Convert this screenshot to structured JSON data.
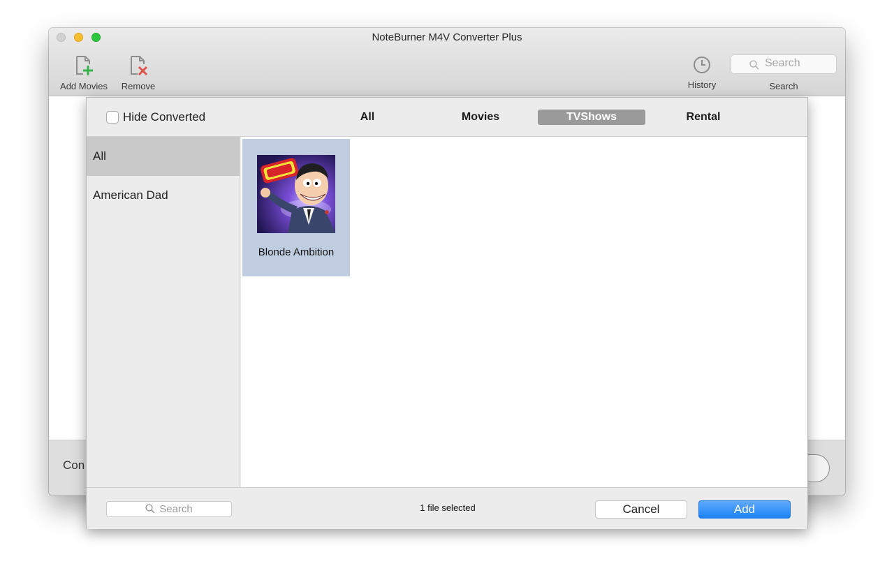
{
  "window": {
    "title": "NoteBurner M4V Converter Plus"
  },
  "toolbar": {
    "add_movies_label": "Add Movies",
    "add_movies_icon": "add-file-icon",
    "remove_label": "Remove",
    "remove_icon": "remove-file-icon",
    "history_label": "History",
    "history_icon": "clock-icon",
    "search_placeholder": "Search",
    "search_label": "Search"
  },
  "main": {
    "bottom_left_text": "Con"
  },
  "dialog": {
    "hide_converted_label": "Hide Converted",
    "hide_converted_checked": false,
    "tabs": [
      {
        "label": "All",
        "selected": false
      },
      {
        "label": "Movies",
        "selected": false
      },
      {
        "label": "TVShows",
        "selected": true
      },
      {
        "label": "Rental",
        "selected": false
      }
    ],
    "sidebar_items": [
      {
        "label": "All",
        "selected": true
      },
      {
        "label": "American Dad",
        "selected": false
      }
    ],
    "items": [
      {
        "title": "Blonde Ambition",
        "selected": true,
        "thumbnail": "american-dad-artwork"
      }
    ],
    "footer": {
      "search_placeholder": "Search",
      "status": "1 file selected",
      "cancel_label": "Cancel",
      "add_label": "Add"
    }
  },
  "colors": {
    "accent_blue": "#1c83f7",
    "selected_tab": "#9a9a9a",
    "selected_tile": "#c0cde0",
    "add_icon_green": "#35b24a",
    "remove_icon_red": "#e0534a"
  }
}
